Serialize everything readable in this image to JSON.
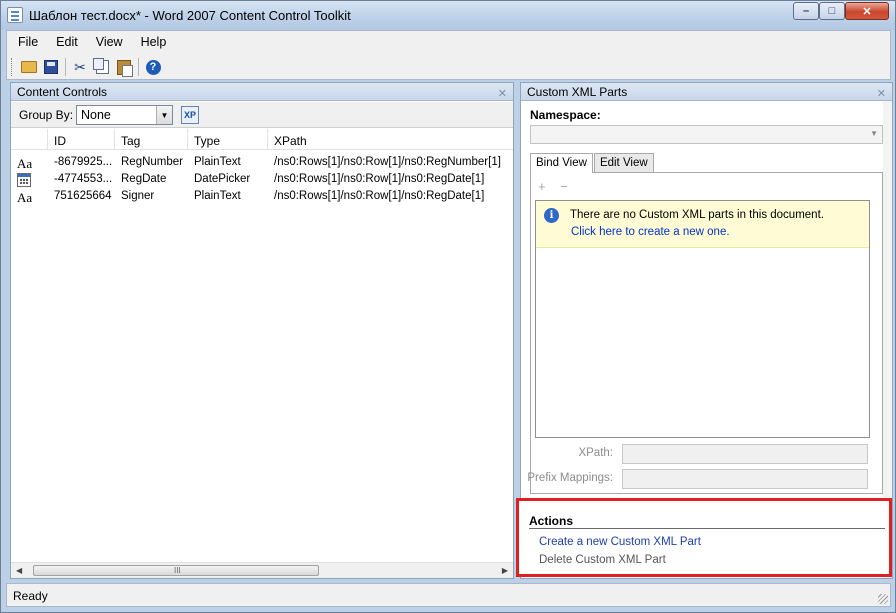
{
  "window": {
    "title": "Шаблон тест.docx* - Word 2007 Content Control Toolkit",
    "minimize_glyph": "–",
    "maximize_glyph": "□",
    "close_glyph": "✕"
  },
  "menu": [
    "File",
    "Edit",
    "View",
    "Help"
  ],
  "toolbar": {
    "icons": [
      "open-icon",
      "save-icon",
      "cut-icon",
      "copy-icon",
      "paste-icon",
      "help-icon"
    ],
    "help_glyph": "?"
  },
  "content_controls": {
    "title": "Content Controls",
    "close_glyph": "✕",
    "group_by_label": "Group By:",
    "group_by_value": "None",
    "columns": [
      "ID",
      "Tag",
      "Type",
      "XPath"
    ],
    "rows": [
      {
        "icon": "Aa",
        "id": "-8679925...",
        "tag": "RegNumber",
        "type": "PlainText",
        "xpath": "/ns0:Rows[1]/ns0:Row[1]/ns0:RegNumber[1]"
      },
      {
        "icon": "calendar-icon",
        "id": "-4774553...",
        "tag": "RegDate",
        "type": "DatePicker",
        "xpath": "/ns0:Rows[1]/ns0:Row[1]/ns0:RegDate[1]"
      },
      {
        "icon": "Aa",
        "id": "751625664",
        "tag": "Signer",
        "type": "PlainText",
        "xpath": "/ns0:Rows[1]/ns0:Row[1]/ns0:RegDate[1]"
      }
    ],
    "scroll_left_glyph": "◀",
    "scroll_right_glyph": "▶",
    "scroll_grip_glyph": "III"
  },
  "custom_xml": {
    "title": "Custom XML Parts",
    "close_glyph": "✕",
    "namespace_label": "Namespace:",
    "namespace_value": "",
    "tabs": [
      "Bind View",
      "Edit View"
    ],
    "add_glyph": "+",
    "remove_glyph": "−",
    "info_glyph": "i",
    "info_text": "There are no Custom XML parts in this document.",
    "info_link": "Click here to create a new one.",
    "xpath_label": "XPath:",
    "prefix_label": "Prefix Mappings:",
    "xpath_value": "",
    "prefix_value": ""
  },
  "actions": {
    "title": "Actions",
    "create_link": "Create a new Custom XML Part",
    "delete_label": "Delete Custom XML Part"
  },
  "status": {
    "text": "Ready"
  }
}
